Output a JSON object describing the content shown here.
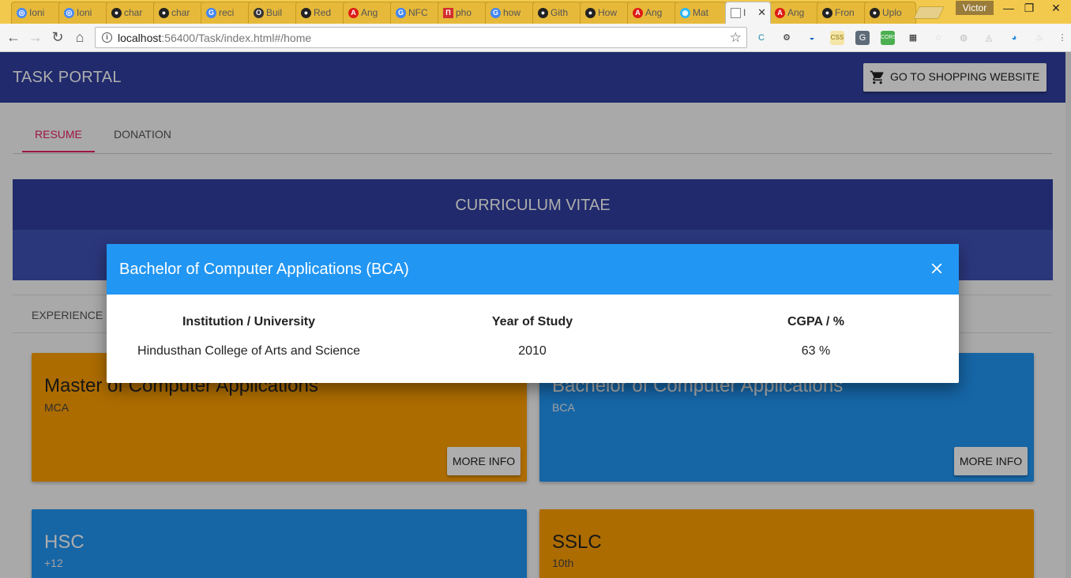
{
  "browser": {
    "tabs": [
      {
        "label": "Ioni",
        "icon": "ionic-icon"
      },
      {
        "label": "Ioni",
        "icon": "ionic-icon"
      },
      {
        "label": "char",
        "icon": "github-icon"
      },
      {
        "label": "char",
        "icon": "github-icon"
      },
      {
        "label": "reci",
        "icon": "google-icon"
      },
      {
        "label": "Buil",
        "icon": "office-icon"
      },
      {
        "label": "Red",
        "icon": "github-icon"
      },
      {
        "label": "Ang",
        "icon": "angular-icon"
      },
      {
        "label": "NFC",
        "icon": "google-icon"
      },
      {
        "label": "pho",
        "icon": "bookmark-icon"
      },
      {
        "label": "how",
        "icon": "google-icon"
      },
      {
        "label": "Gith",
        "icon": "github-icon"
      },
      {
        "label": "How",
        "icon": "github-icon"
      },
      {
        "label": "Ang",
        "icon": "angular-icon"
      },
      {
        "label": "Mat",
        "icon": "material-icon"
      },
      {
        "label": "I",
        "icon": "page-icon"
      },
      {
        "label": "Ang",
        "icon": "angular-icon"
      },
      {
        "label": "Fron",
        "icon": "github-icon"
      },
      {
        "label": "Uplo",
        "icon": "github-icon"
      }
    ],
    "profile": "Victor",
    "url_host": "localhost",
    "url_path": ":56400/Task/index.html#/home"
  },
  "app": {
    "brand": "TASK PORTAL",
    "shop_button": "GO TO SHOPPING WEBSITE",
    "tabs": {
      "resume": "RESUME",
      "donation": "DONATION"
    },
    "cv_title": "CURRICULUM VITAE",
    "inner_tab": "EXPERIENCE I",
    "cards": [
      {
        "title": "Master of Computer Applications",
        "subtitle": "MCA",
        "button": "MORE INFO"
      },
      {
        "title": "Bachelor of Computer Applications",
        "subtitle": "BCA",
        "button": "MORE INFO"
      },
      {
        "title": "HSC",
        "subtitle": "+12"
      },
      {
        "title": "SSLC",
        "subtitle": "10th"
      }
    ]
  },
  "dialog": {
    "title": "Bachelor of Computer Applications (BCA)",
    "columns": [
      "Institution / University",
      "Year of Study",
      "CGPA / %"
    ],
    "row": [
      "Hindusthan College of Arts and Science",
      "2010",
      "63 %"
    ]
  },
  "colors": {
    "primary": "#303f9f",
    "primary_light": "#3f51b5",
    "accent": "#e91e63",
    "card_orange": "#ffa000",
    "card_blue": "#2196f3",
    "dialog_header": "#2196f3"
  }
}
